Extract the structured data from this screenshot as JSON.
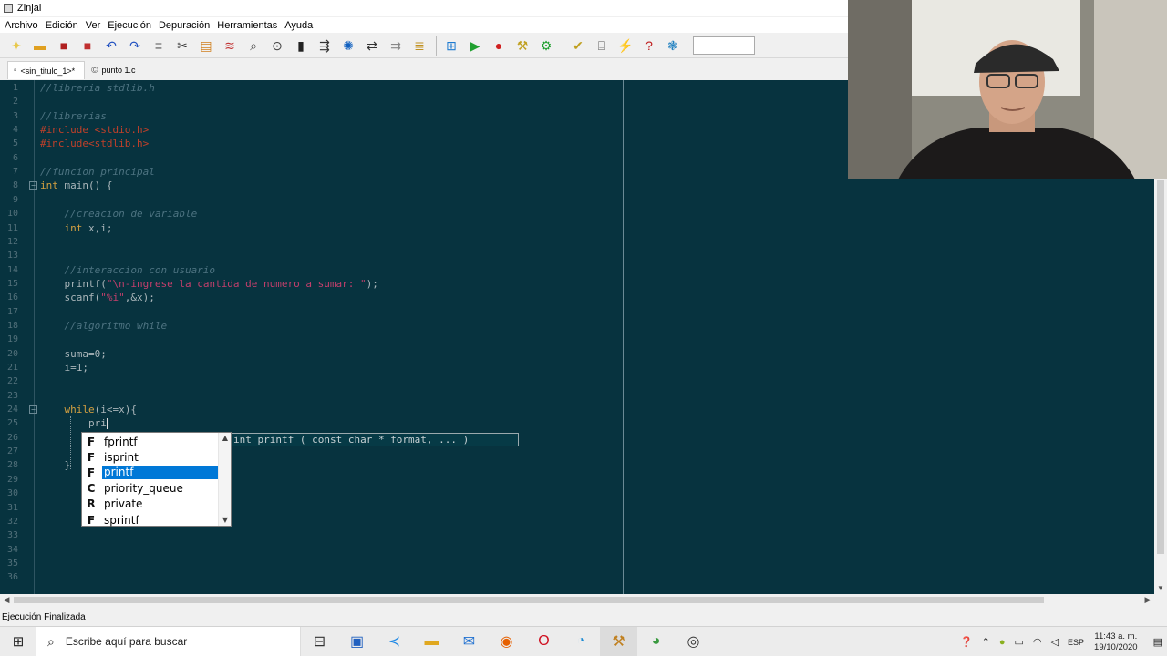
{
  "window": {
    "title": "Zinjal"
  },
  "menu": [
    "Archivo",
    "Edición",
    "Ver",
    "Ejecución",
    "Depuración",
    "Herramientas",
    "Ayuda"
  ],
  "toolbar": {
    "icons": [
      "new-file-icon",
      "open-file-icon",
      "save-icon",
      "save-as-icon",
      "undo-icon",
      "redo-icon",
      "format-icon",
      "cut-icon",
      "copy-icon",
      "paste-icon",
      "find-icon",
      "find-replace-icon",
      "search-icon",
      "indent-icon",
      "comment-icon",
      "uncomment-icon",
      "settings-icon",
      "options-icon",
      "compile-icon",
      "run-icon",
      "stop-icon",
      "build-icon",
      "debug-icon",
      "check-icon",
      "inspect-icon",
      "tools-icon",
      "help-icon",
      "web-icon"
    ]
  },
  "tabs": [
    {
      "label": "<sin_titulo_1>*",
      "active": true
    },
    {
      "label": "punto 1.c",
      "active": false
    }
  ],
  "editor": {
    "lines": [
      {
        "n": "1",
        "tokens": [
          {
            "c": "t-comment",
            "t": "//libreria stdlib.h"
          }
        ]
      },
      {
        "n": "2",
        "tokens": []
      },
      {
        "n": "3",
        "tokens": [
          {
            "c": "t-comment",
            "t": "//librerias"
          }
        ]
      },
      {
        "n": "4",
        "tokens": [
          {
            "c": "t-pre",
            "t": "#include <stdio.h>"
          }
        ]
      },
      {
        "n": "5",
        "tokens": [
          {
            "c": "t-pre",
            "t": "#include<stdlib.h>"
          }
        ]
      },
      {
        "n": "6",
        "tokens": []
      },
      {
        "n": "7",
        "tokens": [
          {
            "c": "t-comment",
            "t": "//funcion principal"
          }
        ]
      },
      {
        "n": "8",
        "fold": true,
        "tokens": [
          {
            "c": "t-kw",
            "t": "int"
          },
          {
            "c": "t-plain",
            "t": " main() {"
          }
        ]
      },
      {
        "n": "9",
        "tokens": []
      },
      {
        "n": "10",
        "tokens": [
          {
            "c": "t-comment",
            "t": "    //creacion de variable"
          }
        ]
      },
      {
        "n": "11",
        "tokens": [
          {
            "c": "t-kw",
            "t": "    int"
          },
          {
            "c": "t-plain",
            "t": " x,i;"
          }
        ]
      },
      {
        "n": "12",
        "tokens": []
      },
      {
        "n": "13",
        "tokens": []
      },
      {
        "n": "14",
        "tokens": [
          {
            "c": "t-comment",
            "t": "    //interaccion con usuario"
          }
        ]
      },
      {
        "n": "15",
        "tokens": [
          {
            "c": "t-plain",
            "t": "    printf("
          },
          {
            "c": "t-str",
            "t": "\"\\n-ingrese la cantida de numero a sumar: \""
          },
          {
            "c": "t-plain",
            "t": ");"
          }
        ]
      },
      {
        "n": "16",
        "tokens": [
          {
            "c": "t-plain",
            "t": "    scanf("
          },
          {
            "c": "t-str",
            "t": "\"%i\""
          },
          {
            "c": "t-plain",
            "t": ",&x);"
          }
        ]
      },
      {
        "n": "17",
        "tokens": []
      },
      {
        "n": "18",
        "tokens": [
          {
            "c": "t-comment",
            "t": "    //algoritmo while"
          }
        ]
      },
      {
        "n": "19",
        "tokens": []
      },
      {
        "n": "20",
        "tokens": [
          {
            "c": "t-plain",
            "t": "    suma=0;"
          }
        ]
      },
      {
        "n": "21",
        "tokens": [
          {
            "c": "t-plain",
            "t": "    i=1;"
          }
        ]
      },
      {
        "n": "22",
        "tokens": []
      },
      {
        "n": "23",
        "tokens": []
      },
      {
        "n": "24",
        "fold": true,
        "tokens": [
          {
            "c": "t-kw",
            "t": "    while"
          },
          {
            "c": "t-plain",
            "t": "(i<=x){"
          }
        ]
      },
      {
        "n": "25",
        "cursor": true,
        "tokens": [
          {
            "c": "t-plain",
            "t": "        pri"
          }
        ]
      },
      {
        "n": "26",
        "tokens": []
      },
      {
        "n": "27",
        "tokens": []
      },
      {
        "n": "28",
        "tokens": [
          {
            "c": "t-plain",
            "t": "    }"
          }
        ]
      },
      {
        "n": "29",
        "tokens": []
      },
      {
        "n": "30",
        "tokens": []
      },
      {
        "n": "31",
        "tokens": []
      },
      {
        "n": "32",
        "tokens": []
      },
      {
        "n": "33",
        "tokens": []
      },
      {
        "n": "34",
        "tokens": []
      },
      {
        "n": "35",
        "tokens": []
      },
      {
        "n": "36",
        "tokens": []
      }
    ]
  },
  "autocomplete": {
    "items": [
      {
        "kind": "F",
        "name": "fprintf",
        "selected": false
      },
      {
        "kind": "F",
        "name": "isprint",
        "selected": false
      },
      {
        "kind": "F",
        "name": "printf",
        "selected": true
      },
      {
        "kind": "C",
        "name": "priority_queue",
        "selected": false
      },
      {
        "kind": "R",
        "name": "private",
        "selected": false
      },
      {
        "kind": "F",
        "name": "sprintf",
        "selected": false
      }
    ],
    "calltip": "int printf ( const char * format, ... )"
  },
  "status": {
    "text": "Ejecución Finalizada"
  },
  "taskbar": {
    "search_placeholder": "Escribe aquí para buscar",
    "language": "ESP",
    "time": "11:43 a. m.",
    "date": "19/10/2020"
  },
  "colors": {
    "editor_bg": "#07333f",
    "selection": "#0078d7"
  }
}
